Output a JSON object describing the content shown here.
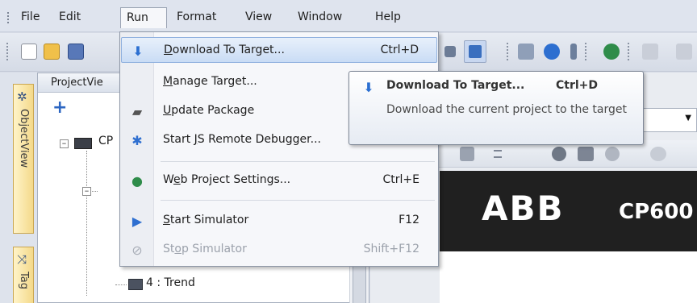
{
  "menubar": {
    "items": [
      "File",
      "Edit",
      "Run",
      "Format",
      "View",
      "Window",
      "Help"
    ],
    "active": "Run"
  },
  "panel": {
    "title": "ProjectVie",
    "tree": {
      "root_label": "CP",
      "trend_label": "4 : Trend"
    }
  },
  "sidetabs": [
    "ObjectView",
    "Tag"
  ],
  "banner": {
    "logo": "ABB",
    "model": "CP600"
  },
  "run_menu": {
    "items": [
      {
        "label": "Download To Target...",
        "mnemonic": "D",
        "shortcut": "Ctrl+D",
        "icon": "download-icon",
        "highlighted": true,
        "enabled": true
      },
      {
        "label": "Manage Target...",
        "mnemonic": "M",
        "shortcut": "",
        "icon": "",
        "highlighted": false,
        "enabled": true
      },
      {
        "label": "Update Package",
        "mnemonic": "U",
        "shortcut": "",
        "icon": "usb-stick-icon",
        "highlighted": false,
        "enabled": true
      },
      {
        "label": "Start JS Remote Debugger...",
        "mnemonic": "J",
        "shortcut": "",
        "icon": "bug-icon",
        "highlighted": false,
        "enabled": true
      },
      {
        "label": "Web Project Settings...",
        "mnemonic": "e",
        "shortcut": "Ctrl+E",
        "icon": "globe-icon",
        "highlighted": false,
        "enabled": true
      },
      {
        "label": "Start Simulator",
        "mnemonic": "S",
        "shortcut": "F12",
        "icon": "play-icon",
        "highlighted": false,
        "enabled": true
      },
      {
        "label": "Stop Simulator",
        "mnemonic": "o",
        "shortcut": "Shift+F12",
        "icon": "stop-icon",
        "highlighted": false,
        "enabled": false
      }
    ]
  },
  "tooltip": {
    "title": "Download To Target...",
    "shortcut": "Ctrl+D",
    "description": "Download the current project to the target"
  },
  "colors": {
    "highlight": "#c9dcf5",
    "menubar": "#dfe4ee",
    "banner": "#202020"
  }
}
